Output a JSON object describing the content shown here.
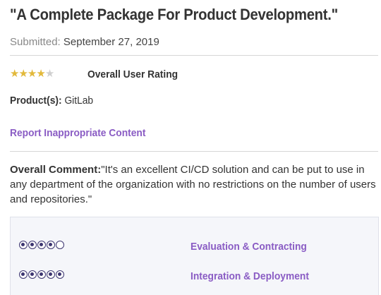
{
  "review": {
    "title": "\"A Complete Package For Product Development.\"",
    "submitted_label": "Submitted:",
    "submitted_date": "September 27, 2019",
    "rating_value": 4,
    "rating_max": 5,
    "rating_label": "Overall User Rating",
    "products_label": "Product(s):",
    "products_value": "GitLab",
    "report_link": "Report Inappropriate Content",
    "comment_label": "Overall Comment:",
    "comment_text": "\"It's an excellent CI/CD solution and can be put to use in any department of the organization with no restrictions on the number of users and repositories.\""
  },
  "metrics": [
    {
      "label": "Evaluation & Contracting",
      "score": 4,
      "max": 5
    },
    {
      "label": "Integration & Deployment",
      "score": 5,
      "max": 5
    }
  ],
  "colors": {
    "star_on": "#e2b93b",
    "star_off": "#cfcfcf",
    "link": "#8a5cc4",
    "dot": "#3c3570"
  }
}
